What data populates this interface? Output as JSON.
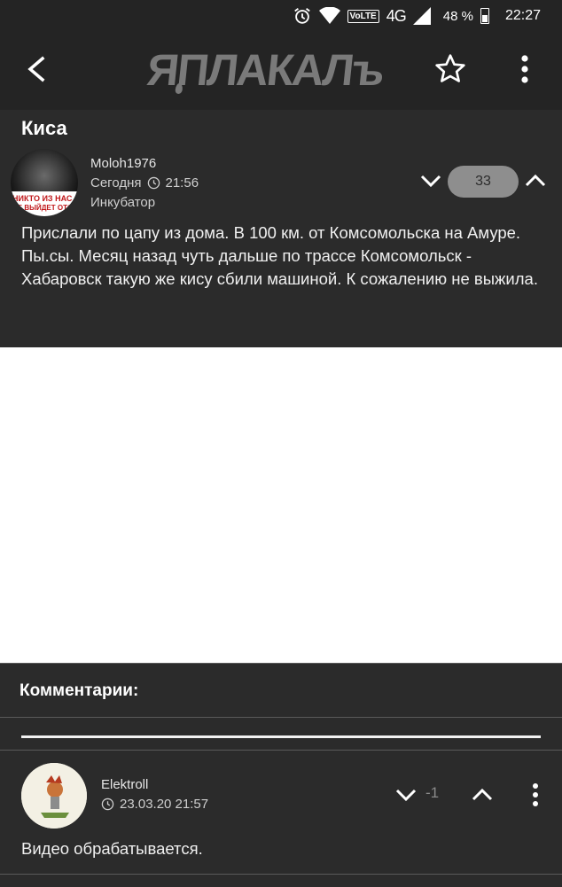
{
  "status_bar": {
    "network": "4G",
    "volte": "VoLTE",
    "battery": "48 %",
    "time": "22:27",
    "icons": [
      "alarm-icon",
      "wifi-icon",
      "signal-icon",
      "battery-icon"
    ]
  },
  "app_bar": {
    "logo_text": "ЯПЛАКАЛъ",
    "icons": [
      "back-arrow-icon",
      "star-icon",
      "more-vert-icon"
    ]
  },
  "post": {
    "title": "Киса",
    "author": "Moloh1976",
    "date": "Сегодня",
    "time": "21:56",
    "rank": "Инкубатор",
    "rating": "33",
    "avatar_text_line1": "НИКТО ИЗ НАС",
    "avatar_text_line2": "НЕ ВЫЙДЕТ ОТСЮДА",
    "body_line1": "Прислали по цапу из дома. В 100 км. от Комсомольска на Амуре.",
    "body_line2": "Пы.сы. Месяц назад чуть дальше по трассе Комсомольск - Хабаровск такую же кису сбили машиной. К сожалению не выжила."
  },
  "comments": {
    "header": "Комментарии:",
    "items": [
      {
        "author": "Elektroll",
        "datetime": "23.03.20 21:57",
        "rating": "-1",
        "text": "Видео обрабатывается."
      }
    ]
  },
  "colors": {
    "background": "#2b2b2b",
    "appbar": "#242424",
    "rating_pill": "#8e8e8e",
    "media_placeholder": "#ffffff"
  }
}
